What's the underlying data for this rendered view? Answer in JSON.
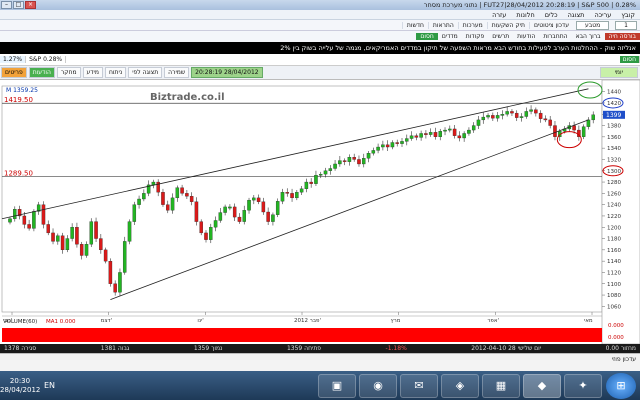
{
  "window": {
    "title": "נתוני מערכת מסחר | FUT27|28/04/2012 20:28:19 | S&P 500 | 0.28%"
  },
  "menu": [
    "קובץ",
    "עריכה",
    "תצוגה",
    "כלים",
    "חלונות",
    "עזרה"
  ],
  "toolbar": {
    "items": [
      "עדכון ציטוטים",
      "תיק השקעות",
      "מערכות",
      "התראות",
      "חדשות"
    ],
    "select_value": "1",
    "select2_value": "מטבע"
  },
  "toolbar2": {
    "items": [
      "ברוך הבא",
      "התחברות",
      "הודעות",
      "תרשים",
      "פקודות",
      "מדדים"
    ],
    "badge_red": "בורסה חיה",
    "badge_green": "חסום"
  },
  "ticker": {
    "text": "אנליזה שוק - ההחלטות הערב לפעילות בחודש הבא מראות השפעה של תיקון במדדים האמריקאים, מגמה של עלייה בשוק בין 2%"
  },
  "symbolbar": {
    "change_box": "1.27%",
    "symbol_box": "S&P 0.28%",
    "green_box": "חסום"
  },
  "chartbar": {
    "buttons": [
      "פריטים",
      "הודעות",
      "מחקר",
      "מידע",
      "ניתוח",
      "תצוגה לפי",
      "שמירה"
    ],
    "time_label": "20:28:19 28/04/2012",
    "symbol": "יומי"
  },
  "chart_data": {
    "type": "candlestick",
    "title": "",
    "ohlc_label": "M 1359.25",
    "watermark": "Biztrade.co.il",
    "left_labels": [
      "1419.50",
      "1289.50"
    ],
    "volume_label": "VOLUME(60)",
    "ma_label": "MA1 0.000",
    "x_ticks": [
      "נוב'",
      "דצמ'",
      "ינו'",
      "2012 פבר'",
      "מרץ",
      "אפר'",
      "מאי"
    ],
    "y_ticks": [
      "1440",
      "1420",
      "1400",
      "1380",
      "1360",
      "1340",
      "1320",
      "1300",
      "1280",
      "1260",
      "1240",
      "1220",
      "1200",
      "1180",
      "1160",
      "1140",
      "1120",
      "1100",
      "1080",
      "1060"
    ],
    "ylim": [
      1050,
      1450
    ],
    "last_price": "1399",
    "marked_price": "1300",
    "circled_price": "1420",
    "volume_axis": [
      "0.000",
      "0.000"
    ],
    "closes": [
      1215,
      1232,
      1220,
      1205,
      1198,
      1228,
      1240,
      1205,
      1190,
      1175,
      1185,
      1160,
      1180,
      1200,
      1170,
      1150,
      1170,
      1210,
      1180,
      1160,
      1140,
      1100,
      1085,
      1120,
      1175,
      1210,
      1240,
      1250,
      1260,
      1275,
      1280,
      1262,
      1240,
      1230,
      1252,
      1270,
      1260,
      1255,
      1245,
      1210,
      1190,
      1178,
      1200,
      1212,
      1226,
      1236,
      1236,
      1218,
      1210,
      1230,
      1248,
      1252,
      1245,
      1227,
      1210,
      1222,
      1246,
      1262,
      1260,
      1252,
      1262,
      1268,
      1280,
      1277,
      1292,
      1294,
      1300,
      1304,
      1312,
      1318,
      1316,
      1324,
      1320,
      1312,
      1322,
      1331,
      1336,
      1342,
      1346,
      1342,
      1350,
      1348,
      1352,
      1357,
      1362,
      1359,
      1366,
      1364,
      1368,
      1360,
      1370,
      1372,
      1374,
      1362,
      1358,
      1366,
      1372,
      1380,
      1390,
      1395,
      1398,
      1393,
      1398,
      1400,
      1405,
      1402,
      1394,
      1396,
      1405,
      1408,
      1402,
      1392,
      1390,
      1380,
      1360,
      1370,
      1374,
      1380,
      1372,
      1360,
      1378,
      1390,
      1399
    ]
  },
  "status": {
    "left": "סגירה 1378",
    "mid1": "גבוה 1381",
    "mid2": "נמוך 1359",
    "mid3": "פתיחה 1359",
    "change": "-1.18%",
    "date": "2012-04-10 יום שלישי 28",
    "right": "מחזור 0.00"
  },
  "bottom_tab": "עדכון פוזי",
  "taskbar": {
    "time": "20:30",
    "date": "28/04/2012",
    "lang": "EN",
    "tasks": [
      "▣",
      "◉",
      "✉",
      "◈",
      "▦",
      "◆",
      "✦"
    ]
  }
}
